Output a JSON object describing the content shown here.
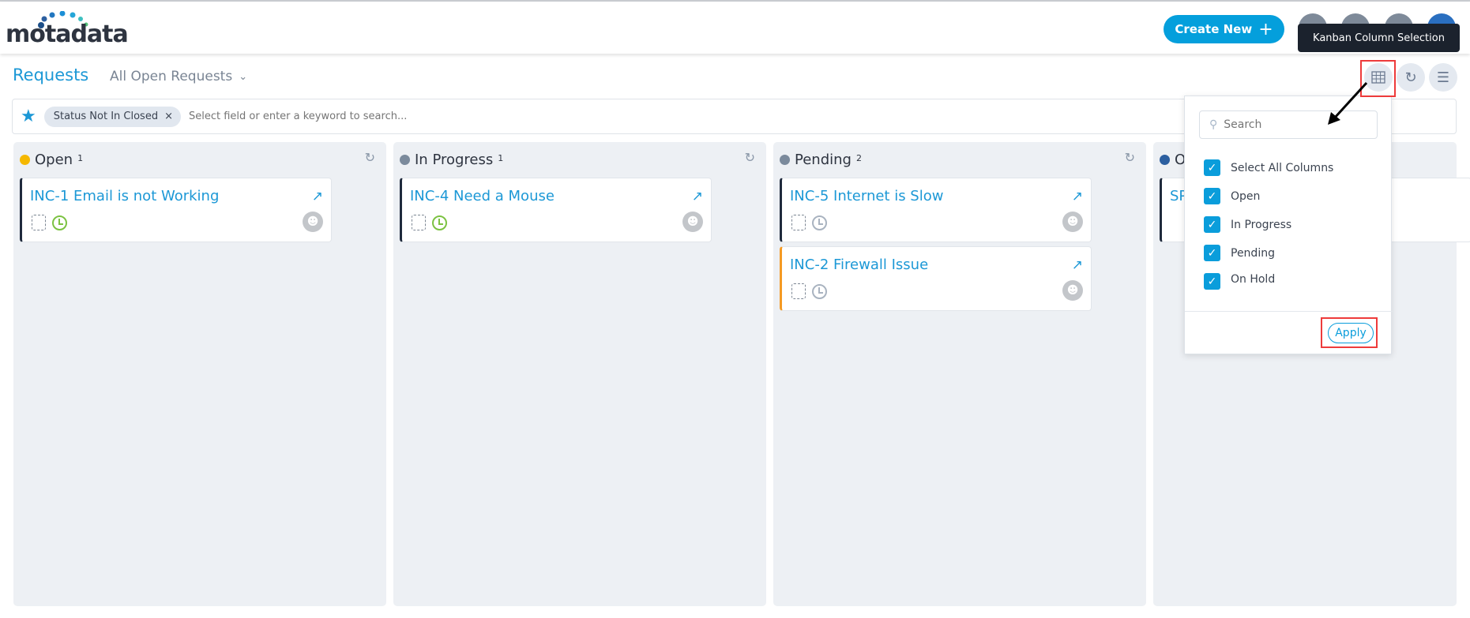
{
  "header": {
    "logo": "motadata",
    "create_new": "Create New",
    "create_icon": "plus-icon",
    "icons": [
      "home-icon",
      "settings-icon",
      "message-icon",
      "user-avatar"
    ]
  },
  "tooltip": "Kanban Column Selection",
  "page": {
    "title": "Requests",
    "view": "All Open Requests"
  },
  "filter": {
    "chip": "Status Not In Closed",
    "placeholder": "Select field or enter a keyword to search..."
  },
  "columns": [
    {
      "name": "Open",
      "count": "1",
      "color": "#f5b800",
      "cards": [
        {
          "title": "INC-1 Email is not Working",
          "border": "#1f2a3c",
          "clock": "#7cc242"
        }
      ]
    },
    {
      "name": "In Progress",
      "count": "1",
      "color": "#7b8a9c",
      "cards": [
        {
          "title": "INC-4 Need a Mouse",
          "border": "#1f2a3c",
          "clock": "#7cc242"
        }
      ]
    },
    {
      "name": "Pending",
      "count": "2",
      "color": "#7b8a9c",
      "cards": [
        {
          "title": "INC-5 Internet is Slow",
          "border": "#1f2a3c",
          "clock": "#a9b3c0"
        },
        {
          "title": "INC-2 Firewall Issue",
          "border": "#f59a23",
          "clock": "#a9b3c0"
        }
      ]
    },
    {
      "name": "O",
      "color": "#2c5fa0",
      "cards": [
        {
          "title": "SP"
        }
      ]
    }
  ],
  "dropdown": {
    "search_placeholder": "Search",
    "options": [
      {
        "label": "Select All Columns",
        "checked": true
      },
      {
        "label": "Open",
        "checked": true
      },
      {
        "label": "In Progress",
        "checked": true
      },
      {
        "label": "Pending",
        "checked": true
      },
      {
        "label": "On Hold",
        "checked": true
      }
    ],
    "apply": "Apply"
  },
  "colors": {
    "accent": "#0a9ddb",
    "highlight": "#ee3b3b"
  }
}
